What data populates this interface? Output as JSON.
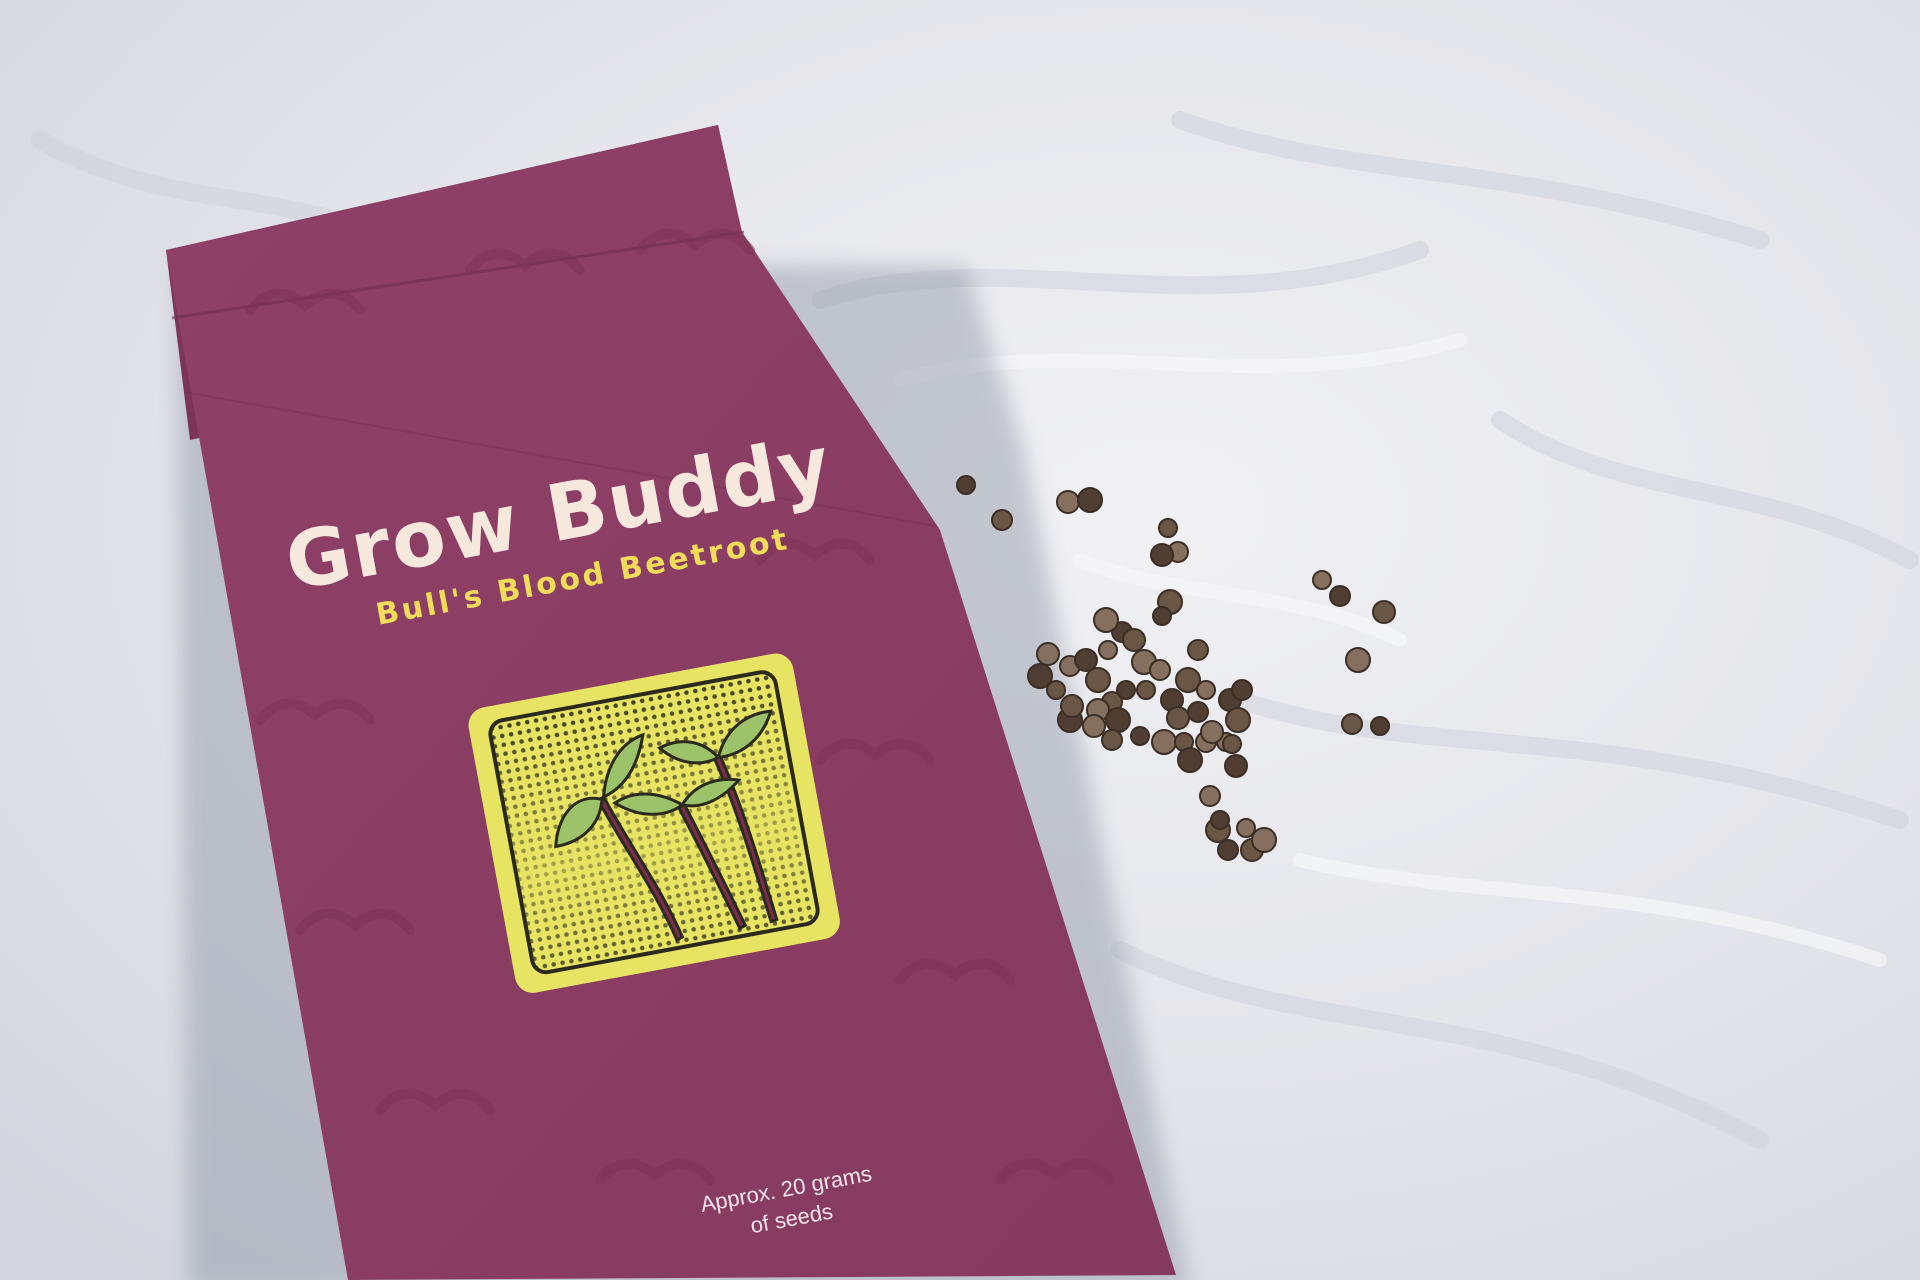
{
  "packet": {
    "brand": "Grow Buddy",
    "variety": "Bull's Blood Beetroot",
    "weight_line_1": "Approx. 20 grams",
    "weight_line_2": "of seeds",
    "illustration": "beet-sprouts-illustration"
  },
  "colors": {
    "packet": "#8b3d63",
    "packet_shadow": "#6f2f4f",
    "brand_text": "#f6e8dc",
    "variety_text": "#f1dc5a",
    "illustration_bg": "#e8e463",
    "seed": "#6a5645",
    "cloth": "#e4e5ea"
  }
}
